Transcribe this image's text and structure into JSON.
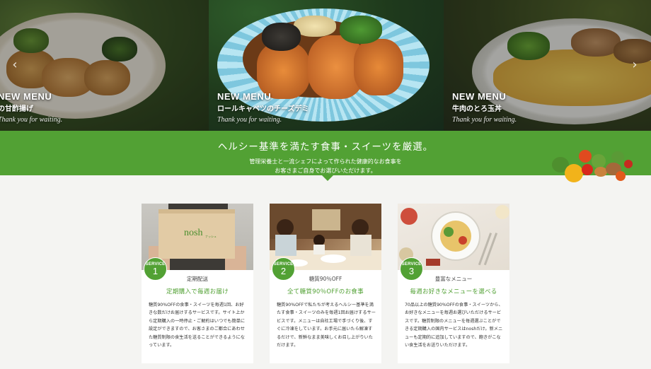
{
  "hero": {
    "slides": [
      {
        "tag": "NEW MENU",
        "name": "の甘酢揚げ",
        "thanks": "Thank you for waiting."
      },
      {
        "tag": "NEW MENU",
        "name": "ロールキャベツのチーズデミ",
        "thanks": "Thank you for waiting."
      },
      {
        "tag": "NEW MENU",
        "name": "牛肉のとろ玉丼",
        "thanks": "Thank you for waiting."
      }
    ],
    "prev_arrow": "‹",
    "next_arrow": "›"
  },
  "banner": {
    "headline": "ヘルシー基準を満たす食事・スイーツを厳選。",
    "sub_line1": "管理栄養士と一流シェフによって作られた健康的なお食事を",
    "sub_line2": "お客さまご自身でお選びいただけます。",
    "color": "#52a134"
  },
  "services": [
    {
      "badge_word": "SERVICE",
      "badge_num": "1",
      "label": "定期配送",
      "title": "定期購入で毎週お届け",
      "body": "糖質90%OFFの食事・スイーツを毎週1回、お好きな数だけお届けするサービスです。サイト上から定期購入の一時停止・ご解約はいつでも簡単に設定ができますので、お客さまのご都合にあわせた糖質制限の食生活を送ることができるようになっています。",
      "box_text": "nosh",
      "box_sub": "ナッシュ"
    },
    {
      "badge_word": "SERVICE",
      "badge_num": "2",
      "label": "糖質90％OFF",
      "title": "全て糖質90％OFFのお食事",
      "body": "糖質90%OFFで私たちが考えるヘルシー基準を満たす食事・スイーツのみを毎週1回お届けするサービスです。メニューは自社工場で手づくり後、すぐに冷凍をしています。お手元に届いたら解凍するだけで、新鮮なまま美味しくお召し上がりいただけます。"
    },
    {
      "badge_word": "SERVICE",
      "badge_num": "3",
      "label": "豊富なメニュー",
      "title": "毎週お好きなメニューを選べる",
      "body": "70品以上の糖質90%OFFの食事・スイーツから、お好きなメニューを毎週お選びいただけるサービスです。糖質制限のメニューを毎週選ぶことができる定期購入の国内サービスはnoshだけ。新メニューも定期的に追加していますので、飽きがこない食生活をお送りいただけます。"
    }
  ]
}
